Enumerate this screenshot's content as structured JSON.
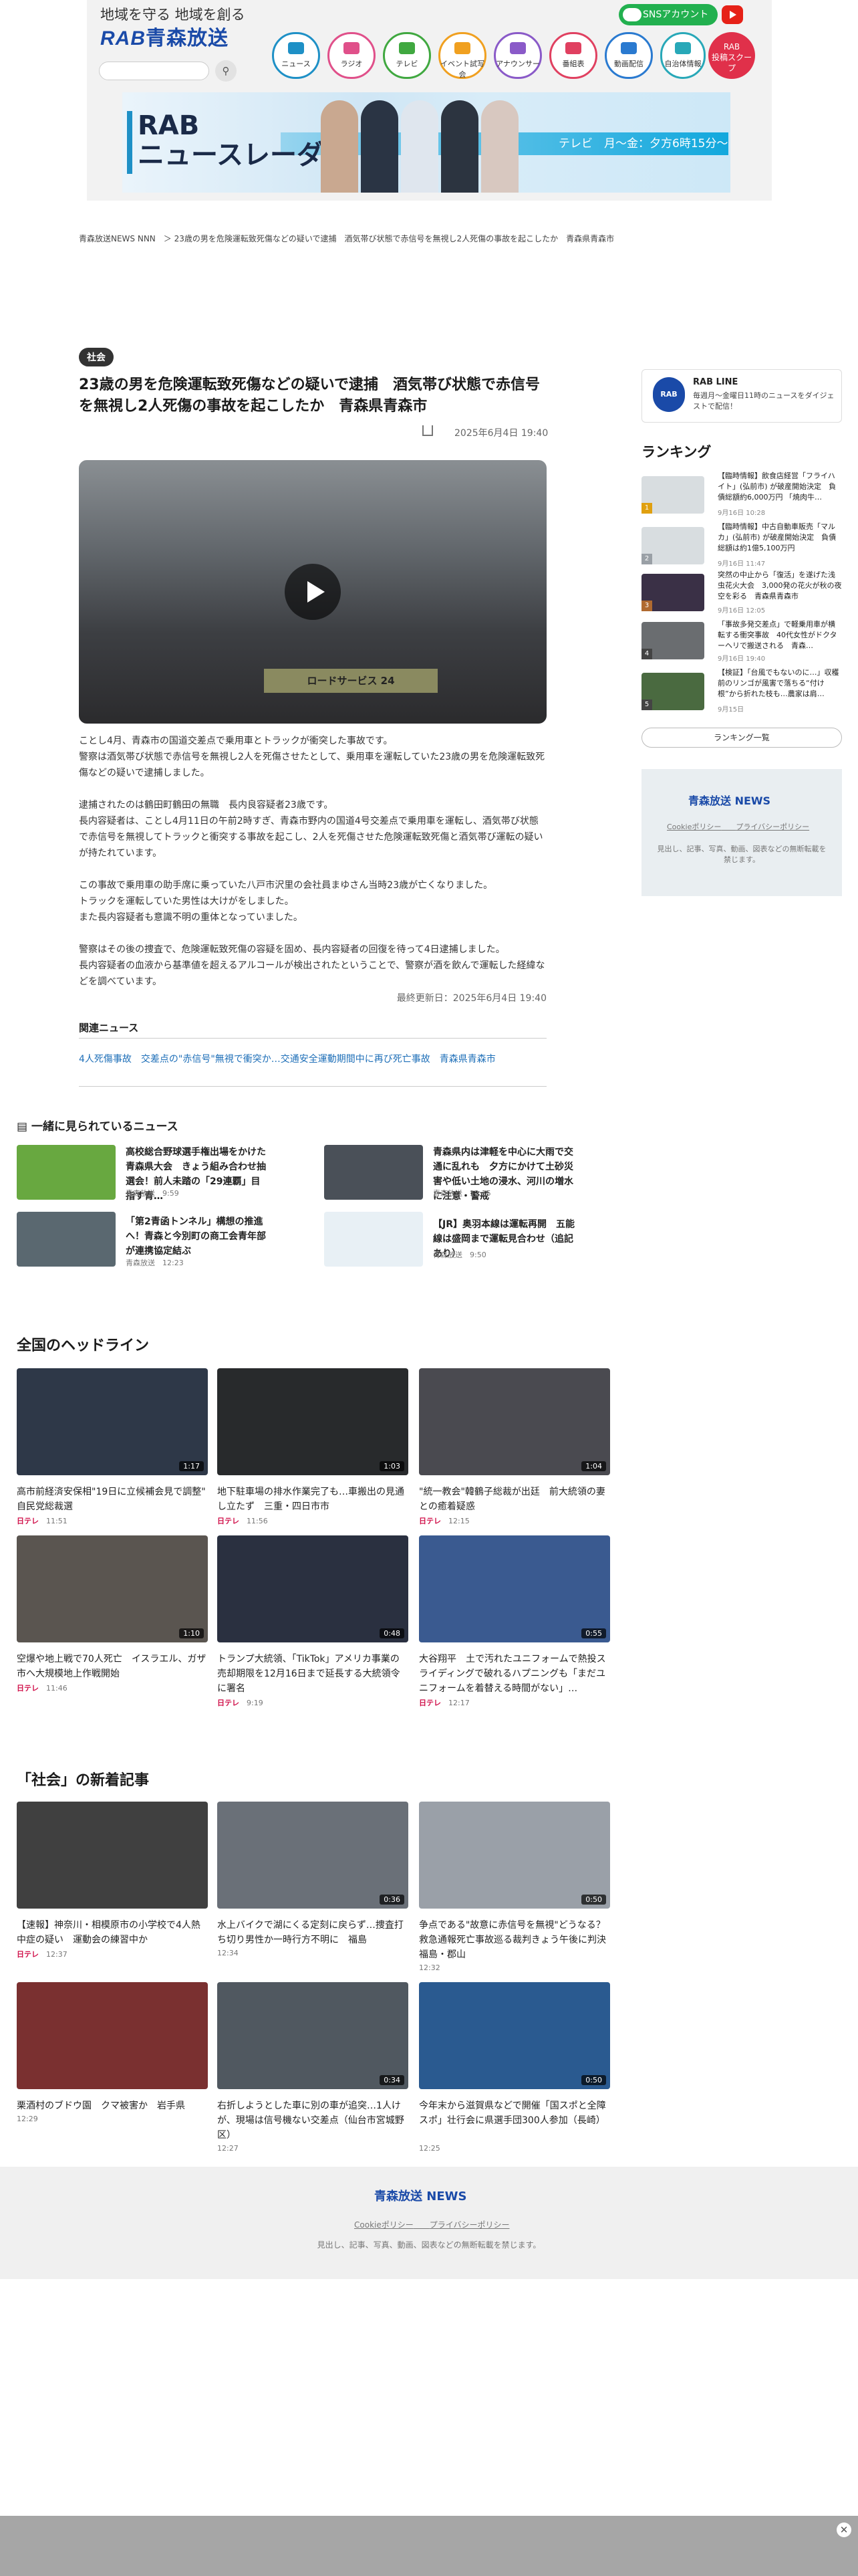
{
  "header": {
    "slogan": "地域を守る 地域を創る",
    "logo_rab": "RAB",
    "logo_name": "青森放送",
    "sns_label": "SNSアカウント",
    "rab_scoop_l1": "RAB",
    "rab_scoop_l2": "投稿スクープ",
    "nav": [
      {
        "label": "ニュース",
        "color": "#1e90c6"
      },
      {
        "label": "ラジオ",
        "color": "#e0508a"
      },
      {
        "label": "テレビ",
        "color": "#40a840"
      },
      {
        "label": "イベント試写会",
        "color": "#f0a020"
      },
      {
        "label": "アナウンサー",
        "color": "#8a5ac8"
      },
      {
        "label": "番組表",
        "color": "#e04060"
      },
      {
        "label": "動画配信",
        "color": "#2a7ad0"
      },
      {
        "label": "自治体情報",
        "color": "#28a8b8"
      }
    ],
    "banner_title_l1": "RAB",
    "banner_title_l2": "ニュースレーダー",
    "banner_time": "テレビ　月〜金：夕方6時15分〜"
  },
  "breadcrumb": "青森放送NEWS NNN　＞ 23歳の男を危険運転致死傷などの疑いで逮捕　酒気帯び状態で赤信号を無視し2人死傷の事故を起こしたか　青森県青森市",
  "article": {
    "category": "社会",
    "title": "23歳の男を危険運転致死傷などの疑いで逮捕　酒気帯び状態で赤信号を無視し2人死傷の事故を起こしたか　青森県青森市",
    "date": "2025年6月4日 19:40",
    "hero_sign": "ロードサービス 24",
    "body": [
      "ことし4月、青森市の国道交差点で乗用車とトラックが衝突した事故です。\n警察は酒気帯び状態で赤信号を無視し2人を死傷させたとして、乗用車を運転していた23歳の男を危険運転致死傷などの疑いで逮捕しました。",
      "逮捕されたのは鶴田町鶴田の無職　長内良容疑者23歳です。\n長内容疑者は、ことし4月11日の午前2時すぎ、青森市野内の国道4号交差点で乗用車を運転し、酒気帯び状態で赤信号を無視してトラックと衝突する事故を起こし、2人を死傷させた危険運転致死傷と酒気帯び運転の疑いが持たれています。",
      "この事故で乗用車の助手席に乗っていた八戸市沢里の会社員まゆさん当時23歳が亡くなりました。\nトラックを運転していた男性は大けがをしました。\nまた長内容疑者も意識不明の重体となっていました。",
      "警察はその後の捜査で、危険運転致死傷の容疑を固め、長内容疑者の回復を待って4日逮捕しました。\n長内容疑者の血液から基準値を超えるアルコールが検出されたということで、警察が酒を飲んで運転した経緯などを調べています。"
    ],
    "updated": "最終更新日：2025年6月4日 19:40",
    "related_heading": "関連ニュース",
    "related_links": "4人死傷事故　交差点の\"赤信号\"無視で衝突か…交通安全運動期間中に再び死亡事故　青森県青森市"
  },
  "sidebar": {
    "rabline_title": "RAB LINE",
    "rabline_desc": "毎週月〜金曜日11時のニュースをダイジェストで配信！",
    "ranking_heading": "ランキング",
    "ranking": [
      {
        "title": "【臨時情報】飲食店経営「フライハイト」(弘前市) が破産開始決定　負債総額約6,000万円 「焼肉牛…",
        "date": "9月16日 10:28",
        "color": "#d8dde0"
      },
      {
        "title": "【臨時情報】中古自動車販売「マルカ」(弘前市) が破産開始決定　負債総額は約1億5,100万円",
        "date": "9月16日 11:47",
        "color": "#d8dde0"
      },
      {
        "title": "突然の中止から「復活」を遂げた浅虫花火大会　3,000発の花火が秋の夜空を彩る　青森県青森市",
        "date": "9月16日 12:05",
        "color": "#3a3046"
      },
      {
        "title": "「事故多発交差点」で軽乗用車が横転する衝突事故　40代女性がドクターヘリで搬送される　青森…",
        "date": "9月16日 19:40",
        "color": "#6a6d70"
      },
      {
        "title": "【検証】「台風でもないのに…」収穫前のリンゴが風害で落ちる“付け根”から折れた枝も…農家は肩…",
        "date": "9月15日",
        "color": "#4a6a40"
      }
    ],
    "ranking_more": "ランキング一覧",
    "footer_logo": "青森放送 NEWS",
    "footer_cookie": "Cookieポリシー",
    "footer_privacy": "プライバシーポリシー",
    "footer_note": "見出し、記事、写真、動画、図表などの無断転載を禁じます。"
  },
  "together": {
    "heading": "一緒に見られているニュース",
    "items": [
      {
        "title": "高校総合野球選手権出場をかけた青森県大会　きょう組み合わせ抽選会！前人未踏の「29連覇」目指す青…",
        "source": "青森放送",
        "time": "9:59",
        "color": "#68a840"
      },
      {
        "title": "青森県内は津軽を中心に大雨で交通に乱れも　夕方にかけて土砂災害や低い土地の浸水、河川の増水に注意・警戒",
        "source": "青森放送",
        "time": "12:15",
        "color": "#4a5058"
      },
      {
        "title": "「第2青函トンネル」構想の推進へ！青森と今別町の商工会青年部が連携協定結ぶ",
        "source": "青森放送",
        "time": "12:23",
        "color": "#5a6870"
      },
      {
        "title": "【JR】奥羽本線は運転再開　五能線は盛岡まで運転見合わせ（追記あり）",
        "source": "青森放送",
        "time": "9:50",
        "color": "#e8f0f5"
      }
    ]
  },
  "national": {
    "heading": "全国のヘッドライン",
    "cards": [
      {
        "title": "高市前経済安保相\"19日に立候補会見で調整\"　自民党総裁選",
        "source": "日テレ",
        "time": "11:51",
        "dur": "1:17",
        "color": "#2e3848"
      },
      {
        "title": "地下駐車場の排水作業完了も…車搬出の見通し立たず　三重・四日市市",
        "source": "日テレ",
        "time": "11:56",
        "dur": "1:03",
        "color": "#282a2c"
      },
      {
        "title": "\"統一教会\"韓鶴子総裁が出廷　前大統領の妻との癒着疑惑",
        "source": "日テレ",
        "time": "12:15",
        "dur": "1:04",
        "color": "#4a4a50"
      },
      {
        "title": "空爆や地上戦で70人死亡　イスラエル、ガザ市へ大規模地上作戦開始",
        "source": "日テレ",
        "time": "11:46",
        "dur": "1:10",
        "color": "#5a5550"
      },
      {
        "title": "トランプ大統領、「TikTok」アメリカ事業の売却期限を12月16日まで延長する大統領令に署名",
        "source": "日テレ",
        "time": "9:19",
        "dur": "0:48",
        "color": "#2a3040"
      },
      {
        "title": "大谷翔平　土で汚れたユニフォームで熱投スライディングで破れるハプニングも「まだユニフォームを着替える時間がない」…",
        "source": "日テレ",
        "time": "12:17",
        "dur": "0:55",
        "color": "#3a5a90"
      }
    ]
  },
  "society": {
    "heading": "「社会」の新着記事",
    "cards": [
      {
        "title": "【速報】神奈川・相模原市の小学校で4人熱中症の疑い　運動会の練習中か",
        "source": "日テレ",
        "time": "12:37",
        "dur": "",
        "color": "#404040"
      },
      {
        "title": "水上バイクで湖にくる定刻に戻らず…捜査打ち切り男性か一時行方不明に　福島",
        "source": "",
        "time": "12:34",
        "dur": "0:36",
        "color": "#6a7078"
      },
      {
        "title": "争点である\"故意に赤信号を無視\"どうなる？　救急通報死亡事故巡る裁判きょう午後に判決　福島・郡山",
        "source": "",
        "time": "12:32",
        "dur": "0:50",
        "color": "#9aa0a8"
      },
      {
        "title": "栗酒村のブドウ園　クマ被害か　岩手県",
        "source": "",
        "time": "12:29",
        "dur": "",
        "color": "#7a3030"
      },
      {
        "title": "右折しようとした車に別の車が追突…1人けが、現場は信号機ない交差点（仙台市宮城野区）",
        "source": "",
        "time": "12:27",
        "dur": "0:34",
        "color": "#505860"
      },
      {
        "title": "今年末から滋賀県などで開催「国スポと全障スポ」壮行会に県選手団300人参加（長崎）",
        "source": "",
        "time": "12:25",
        "dur": "0:50",
        "color": "#2a5a90"
      }
    ]
  },
  "footer": {
    "logo": "青森放送 NEWS",
    "cookie": "Cookieポリシー",
    "privacy": "プライバシーポリシー",
    "note": "見出し、記事、写真、動画、図表などの無断転載を禁じます。"
  }
}
